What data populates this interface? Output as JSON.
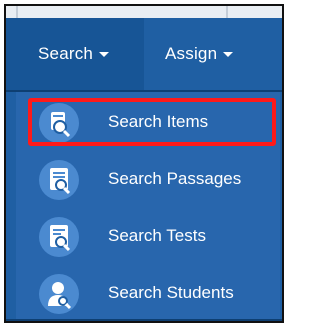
{
  "navbar": {
    "items": [
      {
        "label": "Search"
      },
      {
        "label": "Assign"
      }
    ]
  },
  "search_menu": {
    "items": [
      {
        "label": "Search Items",
        "icon": "search-items-icon",
        "highlighted": true
      },
      {
        "label": "Search Passages",
        "icon": "search-passages-icon"
      },
      {
        "label": "Search Tests",
        "icon": "search-tests-icon"
      },
      {
        "label": "Search Students",
        "icon": "search-students-icon"
      }
    ]
  },
  "colors": {
    "navbar_bg": "#1f5fa3",
    "active_nav_bg": "#175596",
    "menu_bg": "#2866ad",
    "icon_circle": "#4b8ad0",
    "highlight_border": "#ff1a1a",
    "text": "#ffffff"
  }
}
